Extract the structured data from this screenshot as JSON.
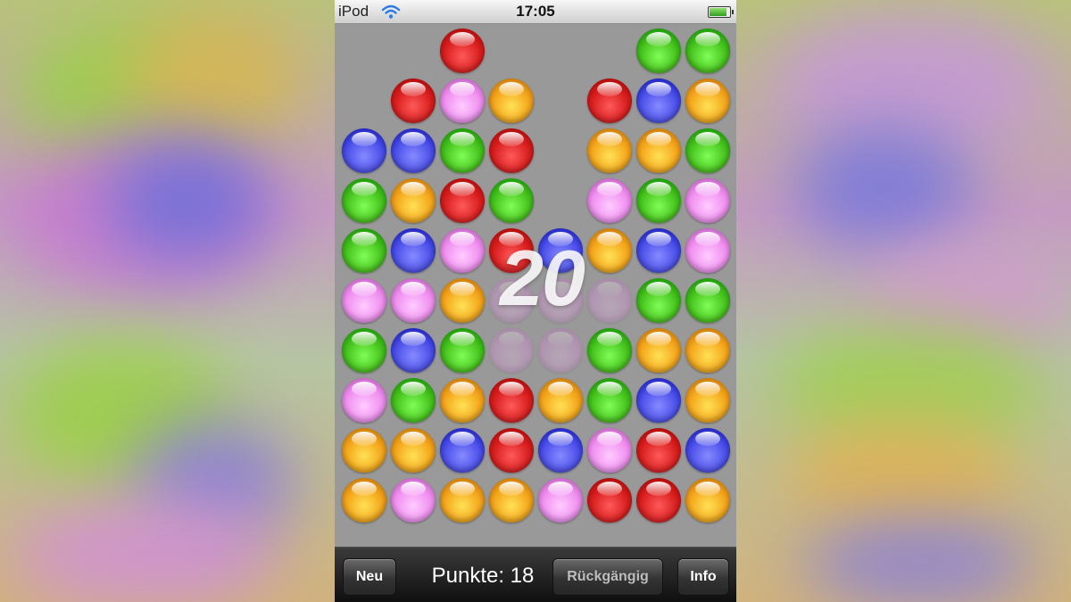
{
  "status_bar": {
    "carrier": "iPod",
    "time": "17:05",
    "wifi_icon": "wifi-icon",
    "battery_icon": "battery-icon",
    "battery_level": 0.85
  },
  "colors": {
    "red": "#d81d1d",
    "pink": "#f08ff0",
    "orange": "#f4a51a",
    "green": "#45c11b",
    "blue": "#4a4ee8"
  },
  "board": {
    "rows": 10,
    "cols": 8,
    "grid": [
      [
        null,
        null,
        "red",
        null,
        null,
        null,
        "green",
        "green"
      ],
      [
        null,
        "red",
        "pink",
        "orange",
        null,
        "red",
        "blue",
        "orange"
      ],
      [
        "blue",
        "blue",
        "green",
        "red",
        null,
        "orange",
        "orange",
        "green"
      ],
      [
        "green",
        "orange",
        "red",
        "green",
        null,
        "pink",
        "green",
        "pink"
      ],
      [
        "green",
        "blue",
        "pink",
        "red",
        "blue",
        "orange",
        "blue",
        "pink"
      ],
      [
        "pink",
        "pink",
        "orange",
        "pink*",
        "pink*",
        "pink*",
        "green",
        "green"
      ],
      [
        "green",
        "blue",
        "green",
        "pink*",
        "pink*",
        "green",
        "orange",
        "orange"
      ],
      [
        "pink",
        "green",
        "orange",
        "red",
        "orange",
        "green",
        "blue",
        "orange"
      ],
      [
        "orange",
        "orange",
        "blue",
        "red",
        "blue",
        "pink",
        "red",
        "blue"
      ],
      [
        "orange",
        "pink",
        "orange",
        "orange",
        "pink",
        "red",
        "red",
        "orange"
      ]
    ],
    "popup_score": "20"
  },
  "toolbar": {
    "new_label": "Neu",
    "points_text": "Punkte: 18",
    "undo_label": "Rückgängig",
    "info_label": "Info"
  }
}
